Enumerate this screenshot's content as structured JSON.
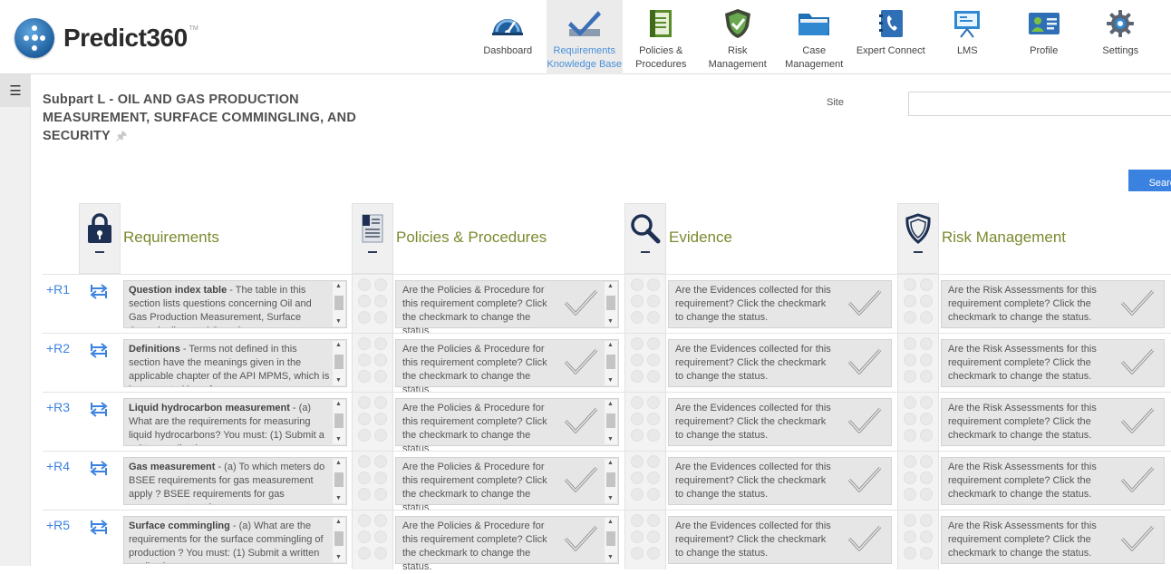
{
  "app": {
    "logo_text": "Predict360",
    "logo_tm": "TM"
  },
  "nav": {
    "items": [
      {
        "label": "Dashboard",
        "icon": "gauge-icon"
      },
      {
        "label": "Requirements Knowledge Base",
        "icon": "checkmark-icon"
      },
      {
        "label": "Policies & Procedures",
        "icon": "document-icon"
      },
      {
        "label": "Risk Management",
        "icon": "shield-icon"
      },
      {
        "label": "Case Management",
        "icon": "folder-icon"
      },
      {
        "label": "Expert Connect",
        "icon": "phone-book-icon"
      },
      {
        "label": "LMS",
        "icon": "presentation-icon"
      },
      {
        "label": "Profile",
        "icon": "id-card-icon"
      },
      {
        "label": "Settings",
        "icon": "gear-icon"
      }
    ],
    "active_index": 1
  },
  "page": {
    "title": "Subpart L - OIL AND GAS PRODUCTION MEASUREMENT, SURFACE COMMINGLING, AND SECURITY",
    "site_label": "Site",
    "site_value": "",
    "search_label": "Search"
  },
  "columns": {
    "requirements": "Requirements",
    "policies": "Policies & Procedures",
    "evidence": "Evidence",
    "risk": "Risk Management"
  },
  "status_text": {
    "policies": "Are the Policies & Procedure for this requirement complete? Click the checkmark to change the status.",
    "evidence": "Are the Evidences collected for this requirement? Click the checkmark to change the status.",
    "risk": "Are the Risk Assessments for this requirement complete? Click the checkmark to change the status."
  },
  "rows": [
    {
      "id": "+R1",
      "title": "Question index table",
      "body": " - The table in this section lists questions concerning Oil and Gas Production Measurement, Surface Commingling, and Security."
    },
    {
      "id": "+R2",
      "title": "Definitions",
      "body": " - Terms not defined in this section have the meanings given in the applicable chapter of the API MPMS, which is incorporated by reference."
    },
    {
      "id": "+R3",
      "title": "Liquid hydrocarbon measurement",
      "body": " - (a) What are the requirements for measuring liquid hydrocarbons? You must: (1) Submit a written application."
    },
    {
      "id": "+R4",
      "title": "Gas measurement",
      "body": " - (a) To which meters do BSEE requirements for gas measurement apply ? BSEE requirements for gas measurement apply."
    },
    {
      "id": "+R5",
      "title": "Surface commingling",
      "body": " - (a) What are the requirements for the surface commingling of production ? You must: (1) Submit a written application."
    }
  ],
  "colors": {
    "accent": "#3b82e0",
    "header_green": "#7a8a2e",
    "navy": "#1d2f52"
  }
}
